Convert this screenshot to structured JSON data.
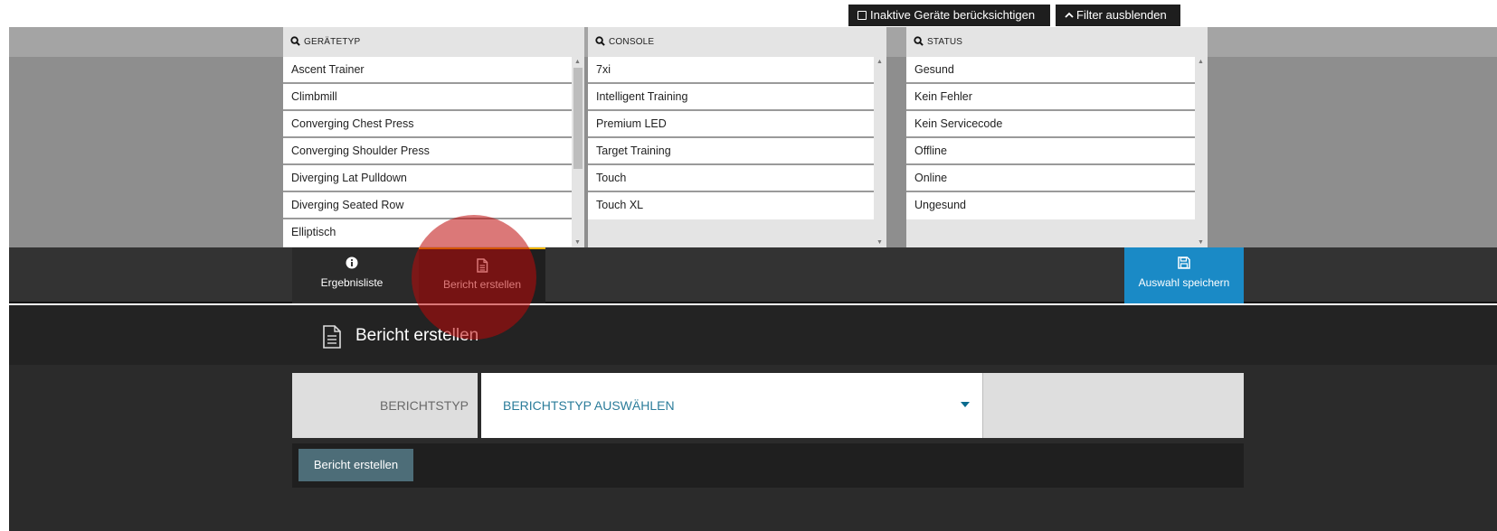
{
  "top_buttons": {
    "inactive_label": "Inaktive Geräte berücksichtigen",
    "filter_label": "Filter ausblenden"
  },
  "filters": {
    "geraetetyp": {
      "header": "GERÄTETYP",
      "items": [
        "Ascent Trainer",
        "Climbmill",
        "Converging Chest Press",
        "Converging Shoulder Press",
        "Diverging Lat Pulldown",
        "Diverging Seated Row",
        "Elliptisch"
      ]
    },
    "console": {
      "header": "CONSOLE",
      "items": [
        "7xi",
        "Intelligent Training",
        "Premium LED",
        "Target Training",
        "Touch",
        "Touch XL"
      ]
    },
    "status": {
      "header": "STATUS",
      "items": [
        "Gesund",
        "Kein Fehler",
        "Kein Servicecode",
        "Offline",
        "Online",
        "Ungesund"
      ]
    }
  },
  "tabs": {
    "results_label": "Ergebnisliste",
    "report_label": "Bericht erstellen",
    "save_label": "Auswahl speichern"
  },
  "section": {
    "title": "Bericht erstellen"
  },
  "form": {
    "report_type_label": "BERICHTSTYP",
    "report_type_value": "BERICHTSTYP AUSWÄHLEN",
    "submit_label": "Bericht erstellen"
  },
  "colors": {
    "accent_blue": "#1a8ac6",
    "active_tab_border": "#f0b400",
    "select_text": "#2b7c9a",
    "button": "#4d6d78"
  }
}
